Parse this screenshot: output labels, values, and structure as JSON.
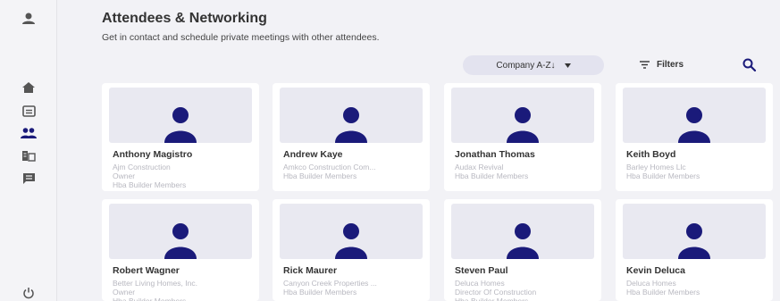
{
  "page": {
    "title": "Attendees & Networking",
    "subtitle": "Get in contact and schedule private meetings with other attendees."
  },
  "toolbar": {
    "sort_label": "Company A-Z↓",
    "filters_label": "Filters"
  },
  "colors": {
    "accent": "#1a1a7a",
    "avatar_bg": "#e9e9f1",
    "muted_text": "#b8b8c0"
  },
  "attendees": [
    {
      "name": "Anthony Magistro",
      "lines": [
        "Ajm Construction",
        "Owner",
        "Hba Builder Members"
      ]
    },
    {
      "name": "Andrew Kaye",
      "lines": [
        "Amkco Construction Com...",
        "Hba Builder Members"
      ]
    },
    {
      "name": "Jonathan Thomas",
      "lines": [
        "Audax Revival",
        "Hba Builder Members"
      ]
    },
    {
      "name": "Keith Boyd",
      "lines": [
        "Barley Homes Llc",
        "Hba Builder Members"
      ]
    },
    {
      "name": "Robert Wagner",
      "lines": [
        "Better Living Homes, Inc.",
        "Owner",
        "Hba Builder Members"
      ]
    },
    {
      "name": "Rick Maurer",
      "lines": [
        "Canyon Creek Properties ...",
        "Hba Builder Members"
      ]
    },
    {
      "name": "Steven Paul",
      "lines": [
        "Deluca Homes",
        "Director Of Construction",
        "Hba Builder Members"
      ]
    },
    {
      "name": "Kevin Deluca",
      "lines": [
        "Deluca Homes",
        "Hba Builder Members"
      ]
    }
  ]
}
